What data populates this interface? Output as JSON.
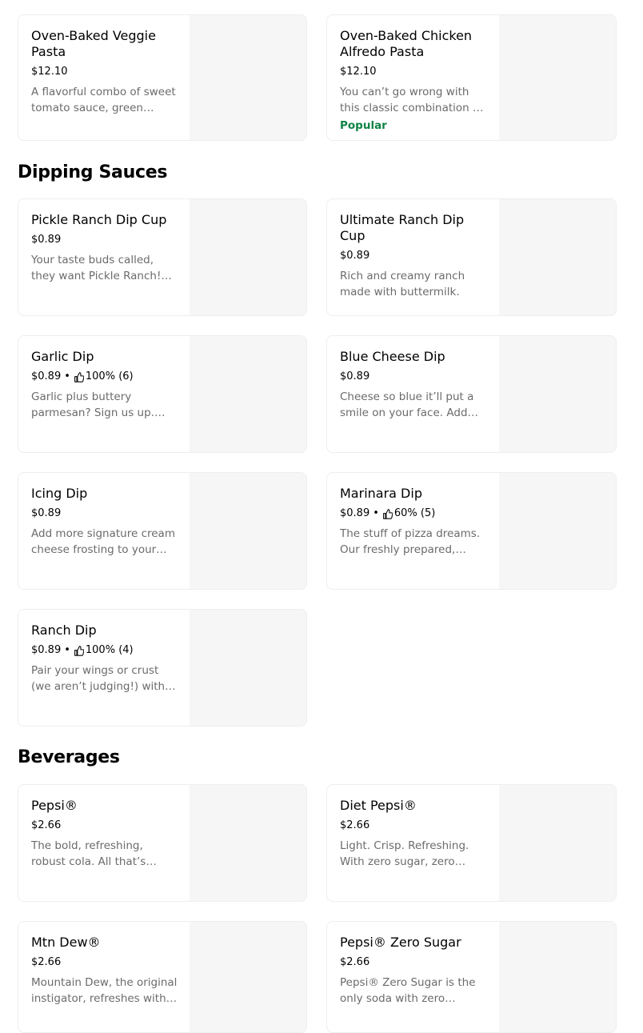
{
  "top_items": [
    {
      "name": "Oven-Baked Veggie Pasta",
      "price": "$12.10",
      "description": "A flavorful combo of sweet tomato sauce, green…"
    },
    {
      "name": "Oven-Baked Chicken Alfredo Pasta",
      "price": "$12.10",
      "description": "You can’t go wrong with this classic combination of our…",
      "badge": "Popular"
    }
  ],
  "sections": {
    "dipping_sauces": {
      "title": "Dipping Sauces",
      "items": [
        {
          "name": "Pickle Ranch Dip Cup",
          "price": "$0.89",
          "description": "Your taste buds called, they want Pickle Ranch! Get this…"
        },
        {
          "name": "Ultimate Ranch Dip Cup",
          "price": "$0.89",
          "description": "Rich and creamy ranch made with buttermilk."
        },
        {
          "name": "Garlic Dip",
          "price": "$0.89",
          "rating": "100% (6)",
          "description": "Garlic plus buttery parmesan? Sign us up. Gre…"
        },
        {
          "name": "Blue Cheese Dip",
          "price": "$0.89",
          "description": "Cheese so blue it’ll put a smile on your face. Add a…"
        },
        {
          "name": "Icing Dip",
          "price": "$0.89",
          "description": "Add more signature cream cheese frosting to your…"
        },
        {
          "name": "Marinara Dip",
          "price": "$0.89",
          "rating": "60% (5)",
          "description": "The stuff of pizza dreams. Our freshly prepared,…"
        },
        {
          "name": "Ranch Dip",
          "price": "$0.89",
          "rating": "100% (4)",
          "description": "Pair your wings or crust (we aren’t judging!) with this…"
        }
      ]
    },
    "beverages": {
      "title": "Beverages",
      "items": [
        {
          "name": "Pepsi®",
          "price": "$2.66",
          "description": "The bold, refreshing, robust cola. All that’s missing are…"
        },
        {
          "name": "Diet Pepsi®",
          "price": "$2.66",
          "description": "Light. Crisp. Refreshing. With zero sugar, zero…"
        },
        {
          "name": "Mtn Dew®",
          "price": "$2.66",
          "description": "Mountain Dew, the original instigator, refreshes with it…"
        },
        {
          "name": "Pepsi® Zero Sugar",
          "price": "$2.66",
          "description": "Pepsi® Zero Sugar is the only soda with zero calories and…"
        }
      ]
    }
  },
  "separator": "•",
  "icons": {
    "rating": "thumbs-up-icon"
  },
  "colors": {
    "badge": "#0e8345",
    "muted_text": "#6b6b6b",
    "image_placeholder": "#f6f6f6"
  }
}
